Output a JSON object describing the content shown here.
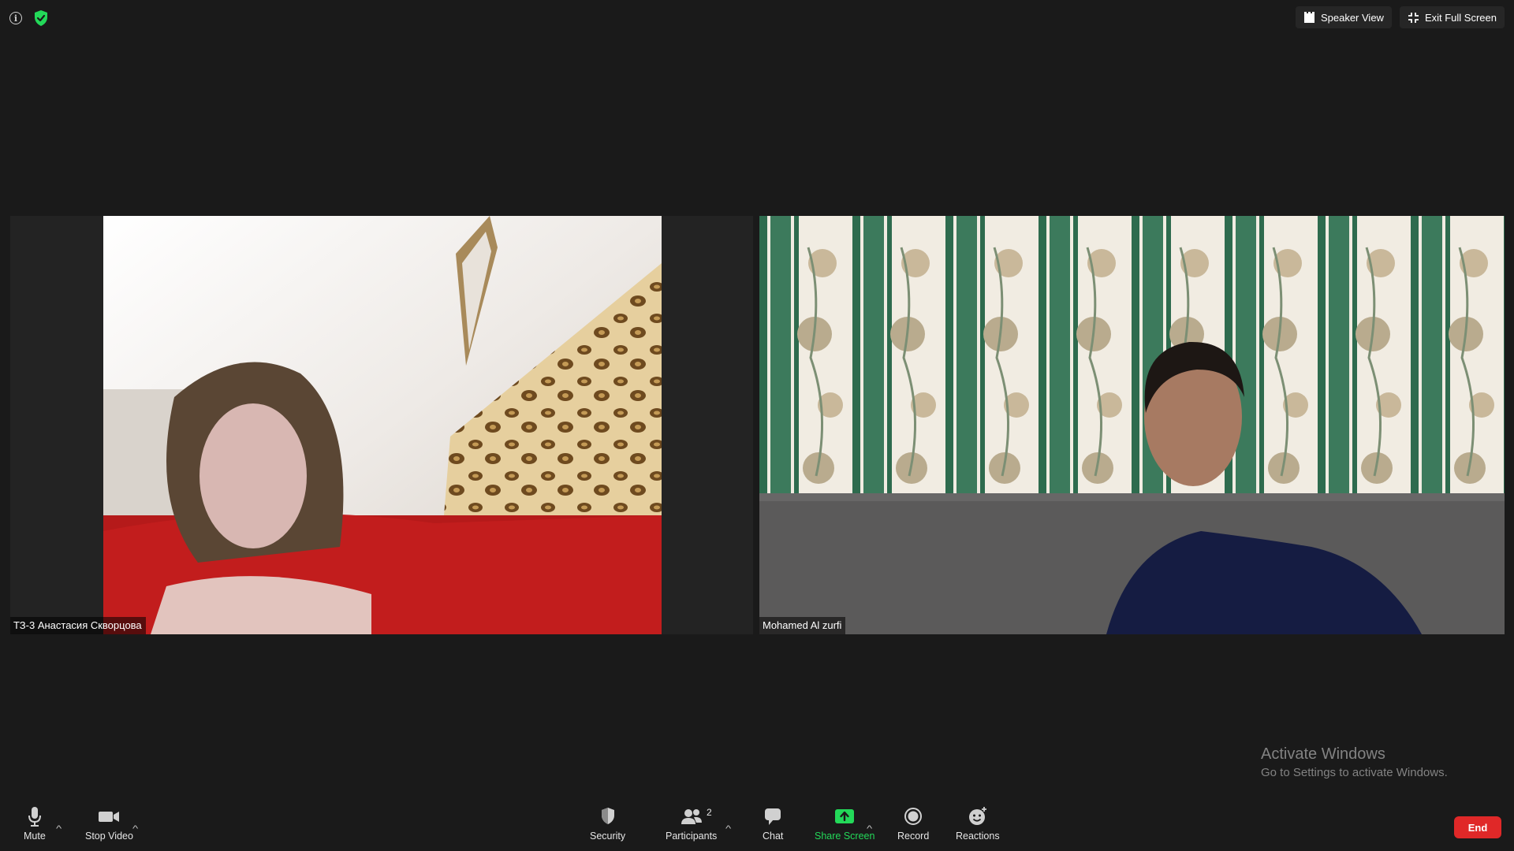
{
  "top_bar": {
    "info_icon": "info-icon",
    "encryption_icon": "shield-check-icon",
    "speaker_view_label": "Speaker View",
    "exit_fullscreen_label": "Exit Full Screen"
  },
  "participants": [
    {
      "name": "ТЗ-3 Анастасия Скворцова"
    },
    {
      "name": "Mohamed Al zurfi"
    }
  ],
  "watermark": {
    "title": "Activate Windows",
    "subtitle": "Go to Settings to activate Windows."
  },
  "toolbar": {
    "mute_label": "Mute",
    "stop_video_label": "Stop Video",
    "security_label": "Security",
    "participants_label": "Participants",
    "participants_count": "2",
    "chat_label": "Chat",
    "share_screen_label": "Share Screen",
    "record_label": "Record",
    "reactions_label": "Reactions",
    "end_label": "End"
  },
  "colors": {
    "background": "#1a1a1a",
    "share_green": "#23d959",
    "end_red": "#e02828",
    "secure_green": "#23d959"
  }
}
